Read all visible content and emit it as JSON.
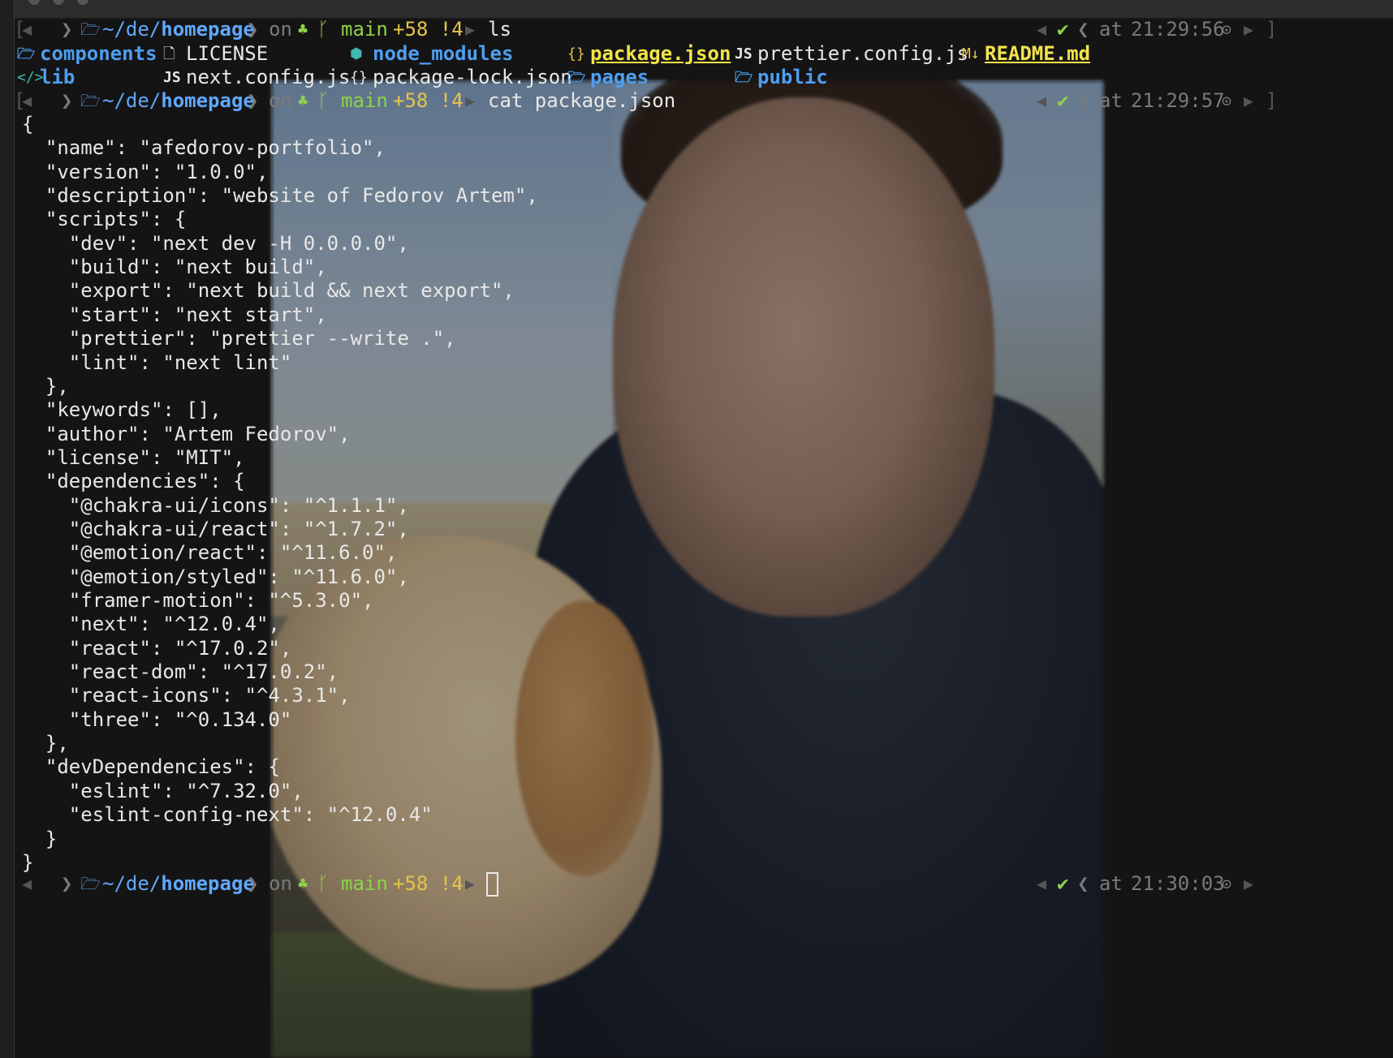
{
  "prompt": {
    "apple_icon": "apple-icon",
    "path_prefix": "~/de/",
    "path_dir": "homepage",
    "on_word": "on",
    "branch": "main",
    "git_status": "+58 !4",
    "at_word": "at",
    "check": "✔"
  },
  "commands": [
    {
      "text": "ls",
      "time": "21:29:56"
    },
    {
      "text": "cat package.json",
      "time": "21:29:57"
    },
    {
      "text": "",
      "time": "21:30:03"
    }
  ],
  "ls_output": [
    {
      "name": "components",
      "kind": "dir",
      "icon": "folder-icon"
    },
    {
      "name": "LICENSE",
      "kind": "file",
      "icon": "document-icon"
    },
    {
      "name": "node_modules",
      "kind": "dir",
      "icon": "node-icon"
    },
    {
      "name": "package.json",
      "kind": "json-highlight",
      "icon": "json-braces-icon"
    },
    {
      "name": "prettier.config.js",
      "kind": "file",
      "icon": "js-icon"
    },
    {
      "name": "README.md",
      "kind": "md-highlight",
      "icon": "markdown-icon"
    },
    {
      "name": "lib",
      "kind": "dir",
      "icon": "code-icon"
    },
    {
      "name": "next.config.js",
      "kind": "file",
      "icon": "js-icon"
    },
    {
      "name": "package-lock.json",
      "kind": "file",
      "icon": "json-braces-icon"
    },
    {
      "name": "pages",
      "kind": "dir",
      "icon": "folder-icon"
    },
    {
      "name": "public",
      "kind": "dir",
      "icon": "folder-icon"
    }
  ],
  "file_lines": [
    "{",
    "  \"name\": \"afedorov-portfolio\",",
    "  \"version\": \"1.0.0\",",
    "  \"description\": \"website of Fedorov Artem\",",
    "  \"scripts\": {",
    "    \"dev\": \"next dev -H 0.0.0.0\",",
    "    \"build\": \"next build\",",
    "    \"export\": \"next build && next export\",",
    "    \"start\": \"next start\",",
    "    \"prettier\": \"prettier --write .\",",
    "    \"lint\": \"next lint\"",
    "  },",
    "  \"keywords\": [],",
    "  \"author\": \"Artem Fedorov\",",
    "  \"license\": \"MIT\",",
    "  \"dependencies\": {",
    "    \"@chakra-ui/icons\": \"^1.1.1\",",
    "    \"@chakra-ui/react\": \"^1.7.2\",",
    "    \"@emotion/react\": \"^11.6.0\",",
    "    \"@emotion/styled\": \"^11.6.0\",",
    "    \"framer-motion\": \"^5.3.0\",",
    "    \"next\": \"^12.0.4\",",
    "    \"react\": \"^17.0.2\",",
    "    \"react-dom\": \"^17.0.2\",",
    "    \"react-icons\": \"^4.3.1\",",
    "    \"three\": \"^0.134.0\"",
    "  },",
    "  \"devDependencies\": {",
    "    \"eslint\": \"^7.32.0\",",
    "    \"eslint-config-next\": \"^12.0.4\"",
    "  }",
    "}"
  ],
  "colors": {
    "background": "#141414",
    "path_blue": "#5fa8ff",
    "branch_green": "#8fd14a",
    "status_yellow": "#e7c547",
    "time_grey": "#7a7a7a",
    "dir_blue": "#4f9ef0",
    "highlight_yellow": "#f2e34a"
  }
}
